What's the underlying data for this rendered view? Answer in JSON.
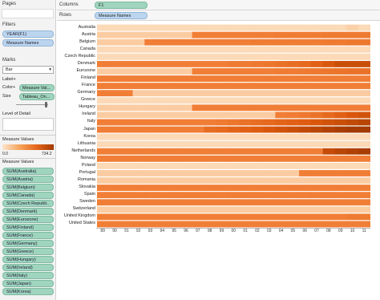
{
  "left_panel": {
    "pages_title": "Pages",
    "filters_title": "Filters",
    "filters": [
      "YEAR(F1)",
      "Measure Names"
    ],
    "marks_title": "Marks",
    "mark_type": "Bar",
    "label_btn": "Label",
    "color_btn": "Color",
    "size_btn": "Size",
    "color_pill": "Measure Val...",
    "size_pill": "Tableau_On...",
    "level_of_detail": "Level of Detail",
    "legend_title": "Measure Values",
    "legend_min": "0.0",
    "legend_max": "734.2",
    "measure_values_title": "Measure Values",
    "measures": [
      "SUM(Australia)",
      "SUM(Austria)",
      "SUM(Belgium)",
      "SUM(Canada)",
      "SUM(Czech Republi..",
      "SUM(Denmark)",
      "SUM(Eurozone)",
      "SUM(Finland)",
      "SUM(France)",
      "SUM(Germany)",
      "SUM(Greece)",
      "SUM(Hungary)",
      "SUM(Ireland)",
      "SUM(Italy)",
      "SUM(Japan)",
      "SUM(Korea)"
    ]
  },
  "shelves": {
    "columns_label": "Columns",
    "columns_pill": "F1",
    "rows_label": "Rows",
    "rows_pill": "Measure Names"
  },
  "chart_data": {
    "type": "heatmap",
    "rows": [
      "Australia",
      "Austria",
      "Belgium",
      "Canada",
      "Czech Republic",
      "Denmark",
      "Eurozone",
      "Finland",
      "France",
      "Germany",
      "Greece",
      "Hungary",
      "Ireland",
      "Italy",
      "Japan",
      "Korea",
      "Lithuania",
      "Netherlands",
      "Norway",
      "Poland",
      "Portugal",
      "Romania",
      "Slovakia",
      "Spain",
      "Sweden",
      "Switzerland",
      "United Kingdom",
      "United States"
    ],
    "x": [
      "89",
      "90",
      "91",
      "92",
      "93",
      "94",
      "95",
      "96",
      "97",
      "98",
      "99",
      "00",
      "01",
      "02",
      "03",
      "04",
      "05",
      "06",
      "07",
      "08",
      "09",
      "10",
      "11"
    ],
    "values": [
      [
        60,
        60,
        60,
        60,
        60,
        60,
        60,
        60,
        60,
        60,
        60,
        60,
        60,
        60,
        60,
        60,
        60,
        60,
        60,
        60,
        60,
        100,
        60
      ],
      [
        120,
        120,
        120,
        120,
        120,
        120,
        120,
        120,
        420,
        420,
        420,
        420,
        420,
        420,
        420,
        430,
        430,
        430,
        430,
        440,
        440,
        440,
        440
      ],
      [
        120,
        120,
        120,
        120,
        420,
        420,
        420,
        420,
        420,
        420,
        420,
        420,
        420,
        430,
        430,
        430,
        430,
        430,
        430,
        440,
        440,
        450,
        450
      ],
      [
        60,
        60,
        60,
        60,
        60,
        60,
        60,
        60,
        60,
        60,
        60,
        60,
        60,
        60,
        60,
        60,
        60,
        60,
        60,
        60,
        60,
        60,
        60
      ],
      [
        60,
        60,
        60,
        60,
        60,
        60,
        60,
        60,
        60,
        60,
        60,
        60,
        60,
        60,
        60,
        60,
        60,
        60,
        60,
        60,
        60,
        60,
        60
      ],
      [
        420,
        420,
        420,
        420,
        420,
        420,
        420,
        420,
        420,
        420,
        420,
        440,
        440,
        450,
        460,
        480,
        500,
        520,
        560,
        600,
        640,
        640,
        640
      ],
      [
        120,
        120,
        120,
        120,
        120,
        120,
        120,
        120,
        420,
        420,
        420,
        420,
        420,
        420,
        420,
        430,
        430,
        440,
        450,
        460,
        470,
        480,
        480
      ],
      [
        420,
        420,
        420,
        420,
        420,
        420,
        420,
        420,
        420,
        420,
        420,
        420,
        420,
        420,
        420,
        420,
        420,
        420,
        420,
        420,
        420,
        420,
        420
      ],
      [
        420,
        420,
        420,
        420,
        420,
        420,
        420,
        420,
        420,
        420,
        420,
        420,
        420,
        420,
        420,
        420,
        420,
        420,
        420,
        420,
        420,
        420,
        420
      ],
      [
        420,
        420,
        420,
        120,
        120,
        120,
        120,
        120,
        120,
        120,
        120,
        120,
        120,
        120,
        120,
        120,
        120,
        120,
        120,
        120,
        120,
        120,
        120
      ],
      [
        60,
        60,
        60,
        60,
        60,
        60,
        60,
        60,
        60,
        60,
        60,
        60,
        60,
        60,
        60,
        60,
        60,
        60,
        60,
        60,
        60,
        60,
        60
      ],
      [
        120,
        120,
        120,
        120,
        120,
        120,
        120,
        120,
        420,
        420,
        420,
        420,
        420,
        420,
        420,
        420,
        420,
        420,
        420,
        420,
        420,
        420,
        420
      ],
      [
        120,
        120,
        120,
        120,
        120,
        120,
        120,
        120,
        120,
        120,
        120,
        120,
        120,
        120,
        120,
        420,
        430,
        450,
        480,
        520,
        560,
        600,
        620
      ],
      [
        420,
        420,
        420,
        420,
        420,
        420,
        420,
        420,
        420,
        420,
        440,
        460,
        480,
        500,
        520,
        540,
        560,
        580,
        600,
        620,
        640,
        660,
        680
      ],
      [
        420,
        420,
        420,
        420,
        420,
        420,
        420,
        420,
        420,
        500,
        520,
        540,
        560,
        580,
        600,
        620,
        640,
        660,
        680,
        700,
        720,
        734,
        734
      ],
      [
        60,
        60,
        60,
        60,
        60,
        60,
        60,
        60,
        60,
        60,
        60,
        60,
        60,
        60,
        60,
        60,
        60,
        60,
        60,
        60,
        60,
        60,
        60
      ],
      [
        60,
        60,
        60,
        60,
        60,
        60,
        60,
        60,
        60,
        60,
        60,
        60,
        60,
        60,
        60,
        60,
        60,
        60,
        60,
        60,
        60,
        60,
        60
      ],
      [
        420,
        420,
        420,
        420,
        420,
        420,
        420,
        420,
        420,
        420,
        420,
        420,
        420,
        420,
        420,
        420,
        420,
        420,
        420,
        650,
        680,
        700,
        720
      ],
      [
        420,
        420,
        420,
        420,
        420,
        420,
        420,
        420,
        420,
        420,
        420,
        420,
        420,
        420,
        420,
        420,
        420,
        420,
        420,
        420,
        420,
        420,
        420
      ],
      [
        60,
        60,
        60,
        60,
        60,
        60,
        60,
        60,
        60,
        60,
        60,
        60,
        60,
        60,
        60,
        60,
        60,
        60,
        60,
        60,
        60,
        60,
        60
      ],
      [
        120,
        120,
        120,
        120,
        120,
        120,
        120,
        120,
        120,
        120,
        120,
        120,
        120,
        120,
        120,
        120,
        120,
        420,
        420,
        420,
        420,
        420,
        420
      ],
      [
        120,
        120,
        120,
        120,
        120,
        120,
        120,
        120,
        120,
        120,
        120,
        120,
        120,
        120,
        120,
        120,
        120,
        120,
        120,
        120,
        120,
        120,
        120
      ],
      [
        420,
        420,
        420,
        420,
        420,
        420,
        420,
        420,
        420,
        420,
        420,
        420,
        420,
        420,
        420,
        420,
        420,
        420,
        420,
        420,
        420,
        420,
        420
      ],
      [
        420,
        420,
        420,
        420,
        420,
        420,
        420,
        420,
        420,
        420,
        420,
        420,
        420,
        420,
        420,
        420,
        420,
        420,
        420,
        420,
        420,
        420,
        420
      ],
      [
        420,
        420,
        420,
        420,
        420,
        420,
        420,
        420,
        420,
        420,
        420,
        420,
        420,
        420,
        420,
        420,
        420,
        420,
        420,
        420,
        420,
        420,
        420
      ],
      [
        120,
        120,
        120,
        120,
        120,
        120,
        120,
        120,
        120,
        120,
        120,
        120,
        120,
        120,
        120,
        120,
        120,
        120,
        120,
        120,
        120,
        120,
        120
      ],
      [
        420,
        420,
        420,
        420,
        420,
        420,
        420,
        420,
        420,
        420,
        420,
        420,
        420,
        420,
        420,
        420,
        420,
        420,
        420,
        420,
        420,
        440,
        440
      ],
      [
        420,
        420,
        420,
        420,
        420,
        420,
        420,
        420,
        420,
        420,
        420,
        420,
        420,
        420,
        420,
        420,
        420,
        420,
        420,
        420,
        420,
        420,
        420
      ]
    ],
    "color_range": [
      0,
      734.2
    ],
    "color_low": "#fde4cc",
    "color_high": "#a33a00"
  }
}
